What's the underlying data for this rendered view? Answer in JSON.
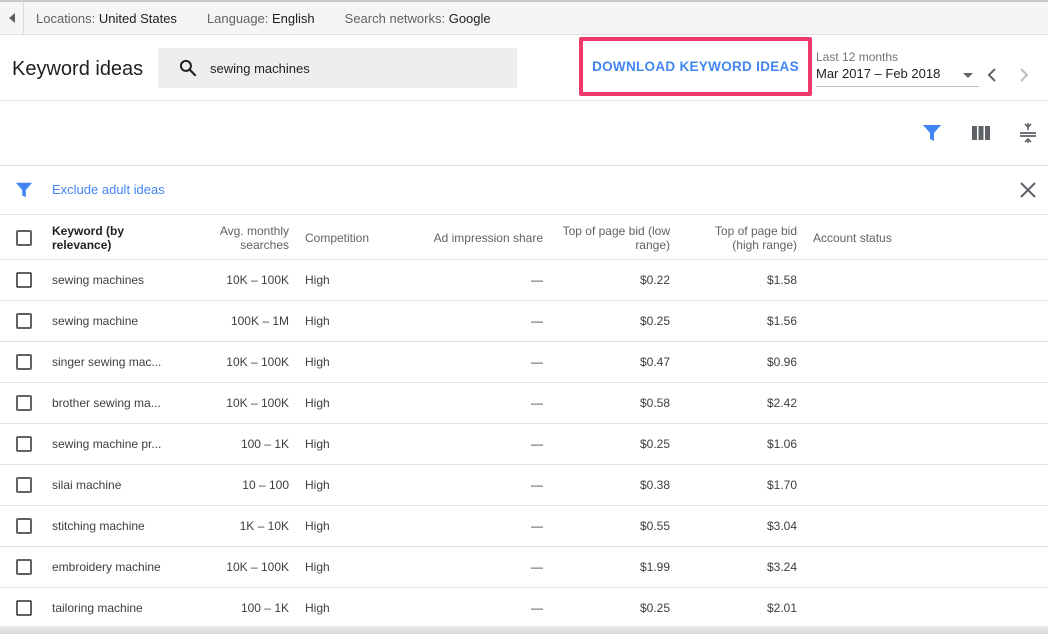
{
  "topbar": {
    "location_label": "Locations:",
    "location_value": "United States",
    "language_label": "Language:",
    "language_value": "English",
    "network_label": "Search networks:",
    "network_value": "Google"
  },
  "header": {
    "title": "Keyword ideas",
    "search_value": "sewing machines",
    "download_label": "DOWNLOAD KEYWORD IDEAS",
    "date_range_label": "Last 12 months",
    "date_range_value": "Mar 2017 – Feb 2018"
  },
  "filter": {
    "link": "Exclude adult ideas"
  },
  "colors": {
    "accent": "#4285f4",
    "highlight_border": "#f0396a"
  },
  "icons": [
    "left-arrow-icon",
    "search-icon",
    "chevron-left-icon",
    "chevron-right-icon",
    "filter-icon",
    "columns-icon",
    "density-icon",
    "close-icon",
    "checkbox-icon"
  ],
  "table": {
    "columns": {
      "keyword": "Keyword (by relevance)",
      "searches": "Avg. monthly searches",
      "competition": "Competition",
      "impression": "Ad impression share",
      "bid_low": "Top of page bid (low range)",
      "bid_high": "Top of page bid (high range)",
      "status": "Account status"
    },
    "rows": [
      {
        "keyword": "sewing machines",
        "searches": "10K – 100K",
        "competition": "High",
        "impression": "—",
        "bid_low": "$0.22",
        "bid_high": "$1.58"
      },
      {
        "keyword": "sewing machine",
        "searches": "100K – 1M",
        "competition": "High",
        "impression": "—",
        "bid_low": "$0.25",
        "bid_high": "$1.56"
      },
      {
        "keyword": "singer sewing mac...",
        "searches": "10K – 100K",
        "competition": "High",
        "impression": "—",
        "bid_low": "$0.47",
        "bid_high": "$0.96"
      },
      {
        "keyword": "brother sewing ma...",
        "searches": "10K – 100K",
        "competition": "High",
        "impression": "—",
        "bid_low": "$0.58",
        "bid_high": "$2.42"
      },
      {
        "keyword": "sewing machine pr...",
        "searches": "100 – 1K",
        "competition": "High",
        "impression": "—",
        "bid_low": "$0.25",
        "bid_high": "$1.06"
      },
      {
        "keyword": "silai machine",
        "searches": "10 – 100",
        "competition": "High",
        "impression": "—",
        "bid_low": "$0.38",
        "bid_high": "$1.70"
      },
      {
        "keyword": "stitching machine",
        "searches": "1K – 10K",
        "competition": "High",
        "impression": "—",
        "bid_low": "$0.55",
        "bid_high": "$3.04"
      },
      {
        "keyword": "embroidery machine",
        "searches": "10K – 100K",
        "competition": "High",
        "impression": "—",
        "bid_low": "$1.99",
        "bid_high": "$3.24"
      },
      {
        "keyword": "tailoring machine",
        "searches": "100 – 1K",
        "competition": "High",
        "impression": "—",
        "bid_low": "$0.25",
        "bid_high": "$2.01"
      }
    ]
  }
}
